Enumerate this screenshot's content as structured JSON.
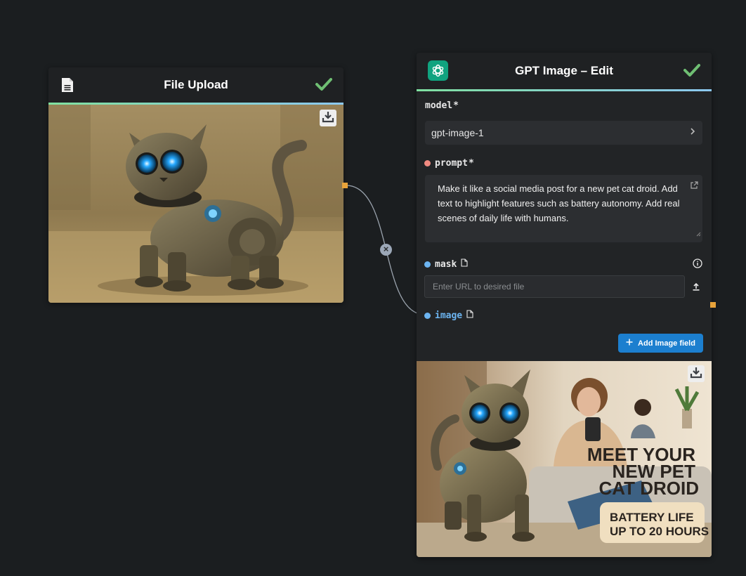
{
  "upload_node": {
    "title": "File Upload",
    "image_alt": "Steampunk robot cat droid sitting on sandy floor"
  },
  "edit_node": {
    "title": "GPT Image – Edit",
    "model": {
      "label": "model",
      "required": "*",
      "value": "gpt-image-1"
    },
    "prompt": {
      "label": "prompt",
      "required": "*",
      "value": "Make it like a social media post for a new pet cat droid. Add text to highlight features such as battery autonomy. Add real scenes of daily life with humans."
    },
    "mask": {
      "label": "mask",
      "placeholder": "Enter URL to desired file"
    },
    "image": {
      "label": "image"
    },
    "add_image_label": "Add Image field",
    "output": {
      "headline": [
        "MEET YOUR",
        "NEW PET",
        "CAT DROID"
      ],
      "badge": [
        "BATTERY LIFE",
        "UP TO 20 HOURS"
      ]
    }
  },
  "edge": {
    "delete_symbol": "×"
  },
  "colors": {
    "canvas_bg": "#1b1e20",
    "node_bg": "#222426",
    "success_check": "#6fbf73",
    "accent_blue": "#1c7fcf",
    "port": "#e8a33a",
    "prompt_dot": "#f08a80",
    "file_dot": "#6cb4f0"
  },
  "icons": [
    "document-icon",
    "checkmark-icon",
    "download-icon",
    "openai-logo-icon",
    "chevron-right-icon",
    "external-link-icon",
    "file-icon",
    "info-icon",
    "upload-icon",
    "plus-icon",
    "delete-edge-icon"
  ]
}
